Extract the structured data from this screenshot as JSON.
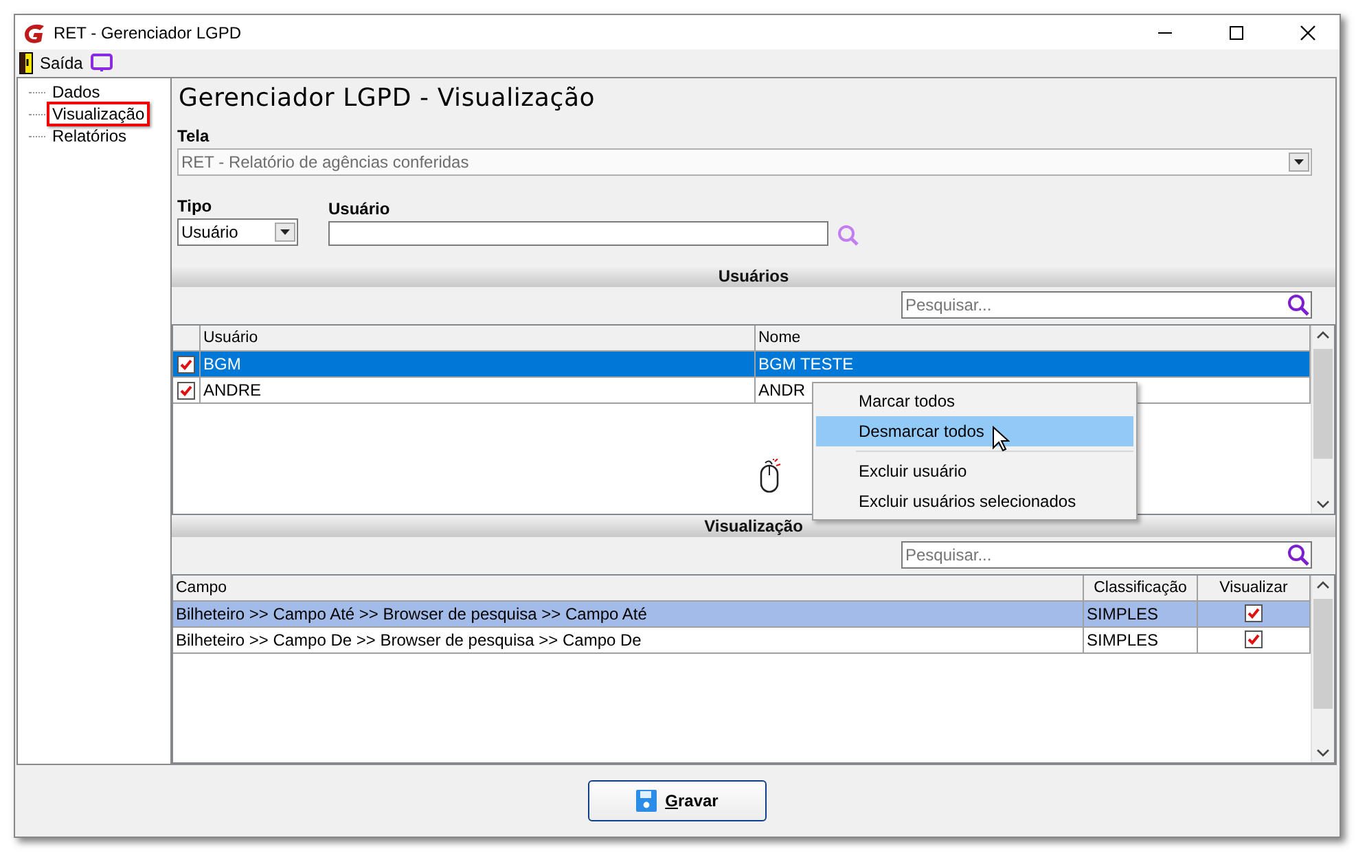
{
  "window": {
    "title": "RET - Gerenciador LGPD"
  },
  "menu": [
    {
      "label": "Saída",
      "kind": "exit"
    },
    {
      "kind": "screen"
    }
  ],
  "sidebar": {
    "items": [
      {
        "label": "Dados",
        "selected": false
      },
      {
        "label": "Visualização",
        "selected": true
      },
      {
        "label": "Relatórios",
        "selected": false
      }
    ]
  },
  "heading": "Gerenciador LGPD - Visualização",
  "tela": {
    "label": "Tela",
    "value": "RET - Relatório de agências conferidas"
  },
  "tipo": {
    "label": "Tipo",
    "value": "Usuário"
  },
  "usuario": {
    "label": "Usuário"
  },
  "users_section": {
    "title": "Usuários",
    "search_placeholder": "Pesquisar...",
    "columns": [
      "Usuário",
      "Nome"
    ],
    "rows": [
      {
        "checked": true,
        "usuario": "BGM",
        "nome": "BGM TESTE",
        "selected": true
      },
      {
        "checked": true,
        "usuario": "ANDRE",
        "nome": "ANDR",
        "selected": false
      }
    ]
  },
  "context_menu": {
    "items": [
      {
        "label": "Marcar todos",
        "selected": false,
        "separator_before": false
      },
      {
        "label": "Desmarcar todos",
        "selected": true,
        "separator_before": false
      },
      {
        "label": "Excluir usuário",
        "selected": false,
        "separator_before": true
      },
      {
        "label": "Excluir usuários selecionados",
        "selected": false,
        "separator_before": false
      }
    ]
  },
  "view_section": {
    "title": "Visualização",
    "search_placeholder": "Pesquisar...",
    "columns": [
      "Campo",
      "Classificação",
      "Visualizar"
    ],
    "rows": [
      {
        "campo": "Bilheteiro >> Campo Até >> Browser de pesquisa >> Campo Até",
        "classificacao": "SIMPLES",
        "visualizar": true,
        "selected": true
      },
      {
        "campo": "Bilheteiro >> Campo De >> Browser de pesquisa >> Campo De",
        "classificacao": "SIMPLES",
        "visualizar": true,
        "selected": false
      }
    ]
  },
  "save_button": "Gravar"
}
